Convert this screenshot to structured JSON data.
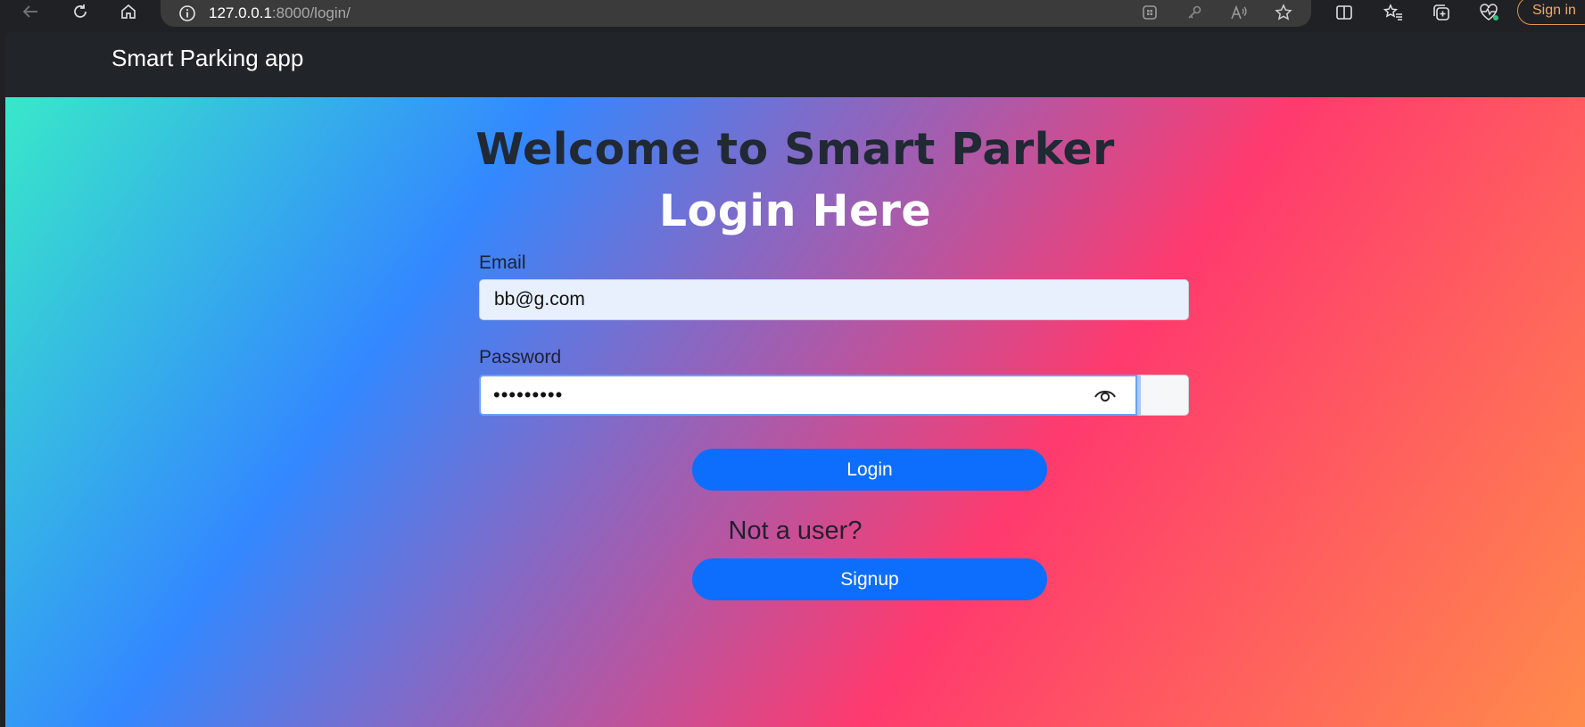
{
  "browser": {
    "url_host": "127.0.0.1",
    "url_rest": ":8000/login/",
    "signin_label": "Sign in",
    "icons": [
      "back-icon",
      "reload-icon",
      "home-icon",
      "info-icon",
      "apps-icon",
      "key-icon",
      "read-aloud-icon",
      "star-icon",
      "split-screen-icon",
      "favorites-icon",
      "collections-icon",
      "health-icon"
    ]
  },
  "navbar": {
    "brand": "Smart Parking app"
  },
  "page": {
    "title": "Welcome to Smart Parker",
    "subtitle": "Login Here",
    "email_label": "Email",
    "email_value": "bb@g.com",
    "password_label": "Password",
    "password_value": "•••••••••",
    "login_button": "Login",
    "not_user_text": "Not a user?",
    "signup_button": "Signup"
  },
  "colors": {
    "navbar_bg": "#212529",
    "button_bg": "#0d6efd",
    "gradient_start": "#38e8c9",
    "gradient_mid1": "#3388ff",
    "gradient_mid2": "#ff3a6e",
    "gradient_end": "#ff8b4b"
  }
}
